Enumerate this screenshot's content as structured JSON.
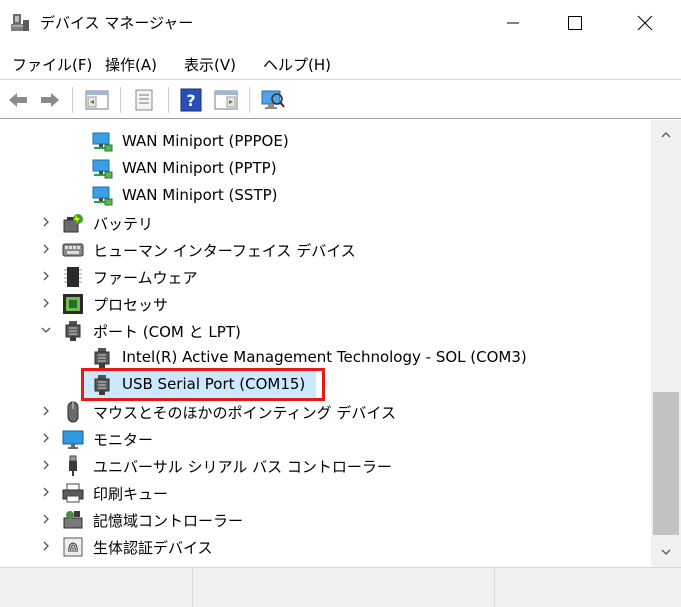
{
  "window": {
    "title": "デバイス マネージャー",
    "icon": "device-manager-icon"
  },
  "menu": [
    "ファイル(F)",
    "操作(A)",
    "表示(V)",
    "ヘルプ(H)"
  ],
  "toolbar": {
    "icons": [
      "back-arrow-icon",
      "forward-arrow-icon",
      "console-tree-icon",
      "properties-icon",
      "help-icon",
      "action-pane-icon",
      "scan-hardware-icon"
    ]
  },
  "tree": {
    "items": [
      {
        "label": "WAN Miniport (PPPOE)",
        "icon": "network-adapter-icon",
        "expandable": false
      },
      {
        "label": "WAN Miniport (PPTP)",
        "icon": "network-adapter-icon",
        "expandable": false
      },
      {
        "label": "WAN Miniport (SSTP)",
        "icon": "network-adapter-icon",
        "expandable": false
      },
      {
        "label": "バッテリ",
        "icon": "battery-icon",
        "expandable": true
      },
      {
        "label": "ヒューマン インターフェイス デバイス",
        "icon": "hid-icon",
        "expandable": true
      },
      {
        "label": "ファームウェア",
        "icon": "firmware-icon",
        "expandable": true
      },
      {
        "label": "プロセッサ",
        "icon": "processor-icon",
        "expandable": true
      },
      {
        "label": "ポート (COM と LPT)",
        "icon": "port-icon",
        "expandable": true,
        "expanded": true
      },
      {
        "label": "Intel(R) Active Management Technology - SOL (COM3)",
        "icon": "port-icon",
        "expandable": false
      },
      {
        "label": "USB Serial Port (COM15)",
        "icon": "port-icon",
        "expandable": false,
        "selected": true
      },
      {
        "label": "マウスとそのほかのポインティング デバイス",
        "icon": "mouse-icon",
        "expandable": true
      },
      {
        "label": "モニター",
        "icon": "monitor-icon",
        "expandable": true
      },
      {
        "label": "ユニバーサル シリアル バス コントローラー",
        "icon": "usb-icon",
        "expandable": true
      },
      {
        "label": "印刷キュー",
        "icon": "printer-icon",
        "expandable": true
      },
      {
        "label": "記憶域コントローラー",
        "icon": "storage-controller-icon",
        "expandable": true
      },
      {
        "label": "生体認証デバイス",
        "icon": "fingerprint-icon",
        "expandable": true
      }
    ]
  },
  "colors": {
    "selection": "#cce8ff",
    "highlight_border": "#e41b17",
    "network": "#1e90d8"
  }
}
